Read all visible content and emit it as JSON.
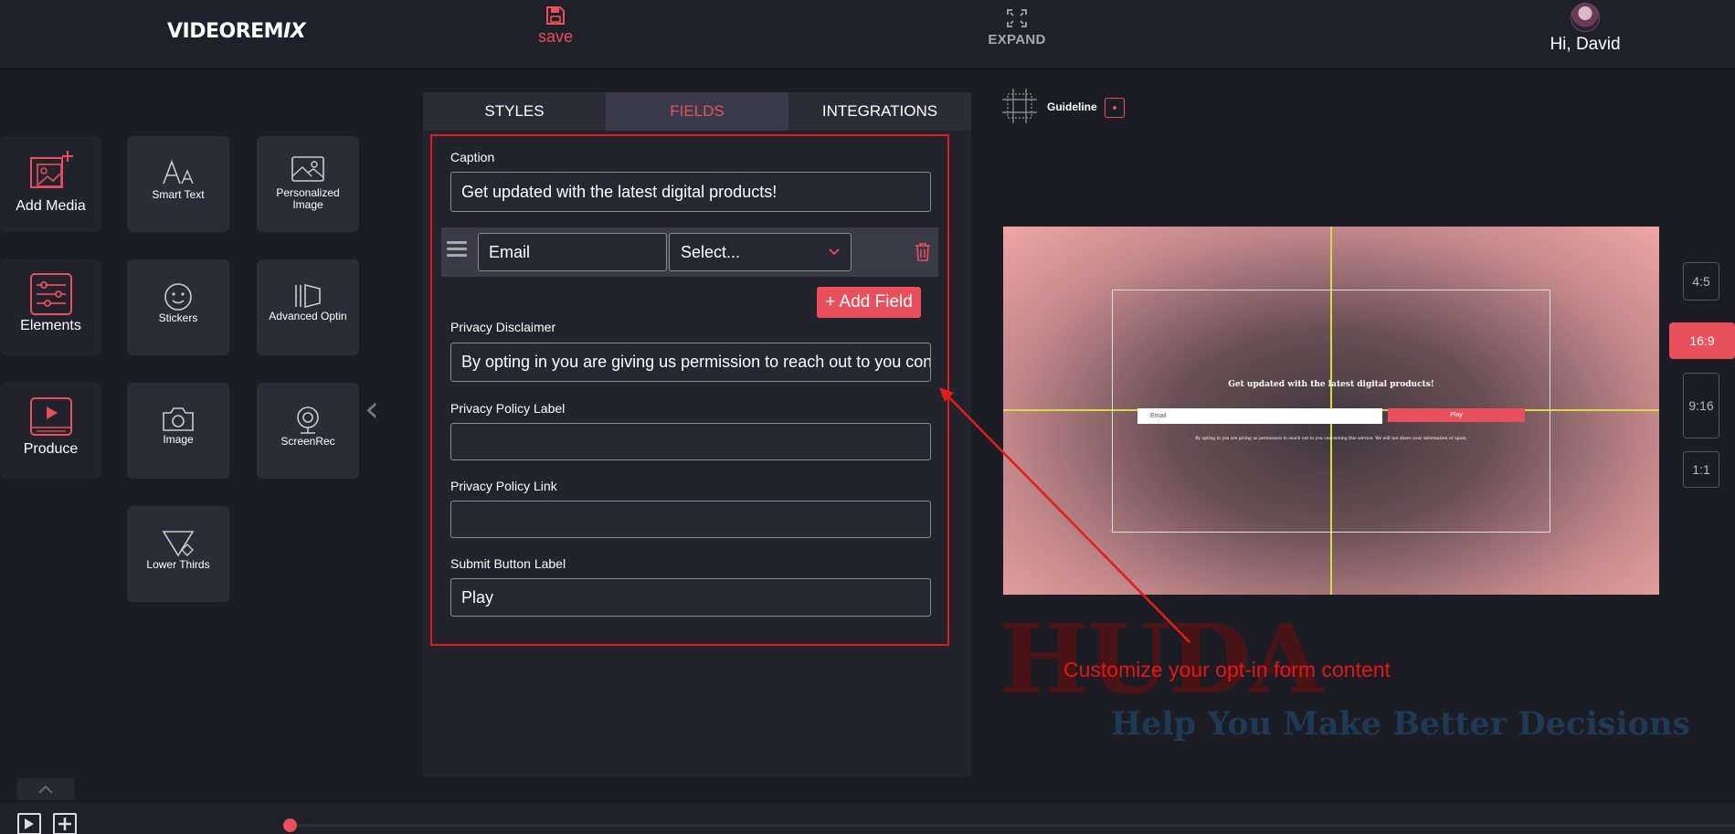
{
  "header": {
    "logo_main": "VIDEOREM",
    "logo_accent": "IX",
    "save_label": "save",
    "expand_label": "EXPAND",
    "greeting": "Hi, David"
  },
  "tools": {
    "add_media": "Add Media",
    "smart_text": "Smart Text",
    "personalized_image": "Personalized Image",
    "elements": "Elements",
    "stickers": "Stickers",
    "advanced_optin": "Advanced Optin",
    "produce": "Produce",
    "image": "Image",
    "screenrec": "ScreenRec",
    "lower_thirds": "Lower Thirds"
  },
  "editor": {
    "tabs": [
      "STYLES",
      "FIELDS",
      "INTEGRATIONS"
    ],
    "active_tab": "FIELDS",
    "caption_label": "Caption",
    "caption_value": "Get updated with the latest digital products!",
    "field_row": {
      "name_value": "Email",
      "type_placeholder": "Select..."
    },
    "add_field_label": "+ Add Field",
    "privacy_disclaimer_label": "Privacy Disclaimer",
    "privacy_disclaimer_value": "By opting in you are giving us permission to reach out to you concerning this service. We will not share your information or spam.",
    "privacy_policy_label_label": "Privacy Policy Label",
    "privacy_policy_label_value": "",
    "privacy_policy_link_label": "Privacy Policy Link",
    "privacy_policy_link_value": "",
    "submit_button_label_label": "Submit Button Label",
    "submit_button_label_value": "Play"
  },
  "preview": {
    "guideline_label": "Guideline",
    "caption": "Get updated with the latest digital products!",
    "email_placeholder": "Email",
    "button_label": "Play",
    "disclaimer": "By opting in you are giving us permission to reach out to you concerning this service. We will not share your information or spam.",
    "ratios": [
      "4:5",
      "16:9",
      "9:16",
      "1:1"
    ],
    "active_ratio": "16:9"
  },
  "annotation": {
    "text": "Customize your opt-in form content",
    "watermark": "HUDA",
    "watermark_tagline": "Help You Make Better Decisions"
  },
  "colors": {
    "accent": "#e8505b",
    "annotation_red": "#e41b1b",
    "guideline_yellow": "#d8d84a",
    "background": "#1b1c24",
    "panel": "#2b2c37"
  }
}
